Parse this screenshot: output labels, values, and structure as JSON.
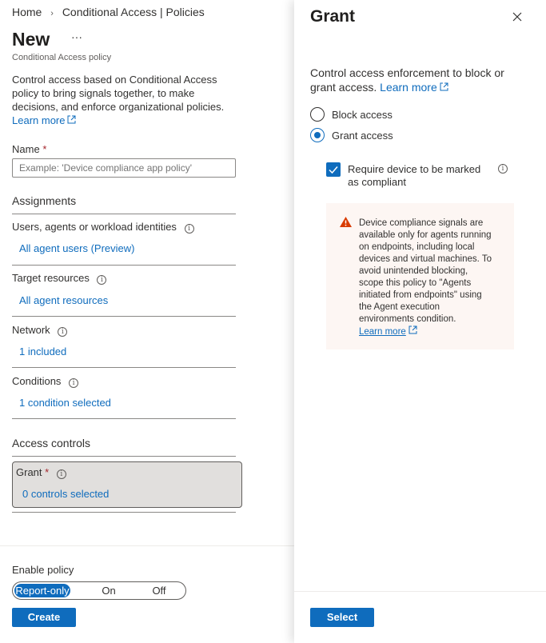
{
  "breadcrumb": {
    "home": "Home",
    "separator": ">",
    "current": "Conditional Access | Policies"
  },
  "page": {
    "title": "New",
    "more": "···",
    "subtitle": "Conditional Access policy"
  },
  "intro": {
    "line1": "Control access based on Conditional Access",
    "line2": "policy to bring signals together, to make",
    "line3": "decisions, and enforce organizational policies.",
    "learn_more": "Learn more"
  },
  "name_field": {
    "label": "Name",
    "required": "*",
    "placeholder": "Example: 'Device compliance app policy'"
  },
  "assignments": {
    "heading": "Assignments",
    "users_label": "Users, agents or workload identities",
    "users_value": "All agent users (Preview)",
    "target_label": "Target resources",
    "target_value": "All agent resources",
    "network_label": "Network",
    "network_value": "1 included",
    "conditions_label": "Conditions",
    "conditions_value": "1 condition selected"
  },
  "access_controls": {
    "heading": "Access controls",
    "grant_label": "Grant",
    "grant_required": "*",
    "grant_value": "0 controls selected"
  },
  "enable_policy": {
    "label": "Enable policy",
    "options": [
      "Report-only",
      "On",
      "Off"
    ],
    "selected": "Report-only"
  },
  "create_button": "Create",
  "grant_panel": {
    "title": "Grant",
    "close": "✕",
    "desc_line1": "Control access enforcement to block or",
    "desc_line2": "grant access.",
    "learn_more": "Learn more",
    "block_access": "Block access",
    "grant_access": "Grant access",
    "selected": "Grant access",
    "require_line1": "Require device to be marked",
    "require_line2": "as compliant",
    "require_checked": true,
    "warning": {
      "l1": "Device compliance signals are",
      "l2": "available only for agents running",
      "l3": "on endpoints, including local",
      "l4": "devices and virtual machines. To",
      "l5": "avoid unintended blocking,",
      "l6": "scope this policy to \"Agents",
      "l7": "initiated from endpoints\" using",
      "l8": "the Agent execution",
      "l9": "environments condition.",
      "learn_more": "Learn more"
    },
    "select_button": "Select"
  },
  "colors": {
    "accent": "#0f6cbd",
    "warning_bg": "#fdf6f3",
    "warning_icon": "#d83b01",
    "grant_selected_bg": "#e1dfdd"
  }
}
